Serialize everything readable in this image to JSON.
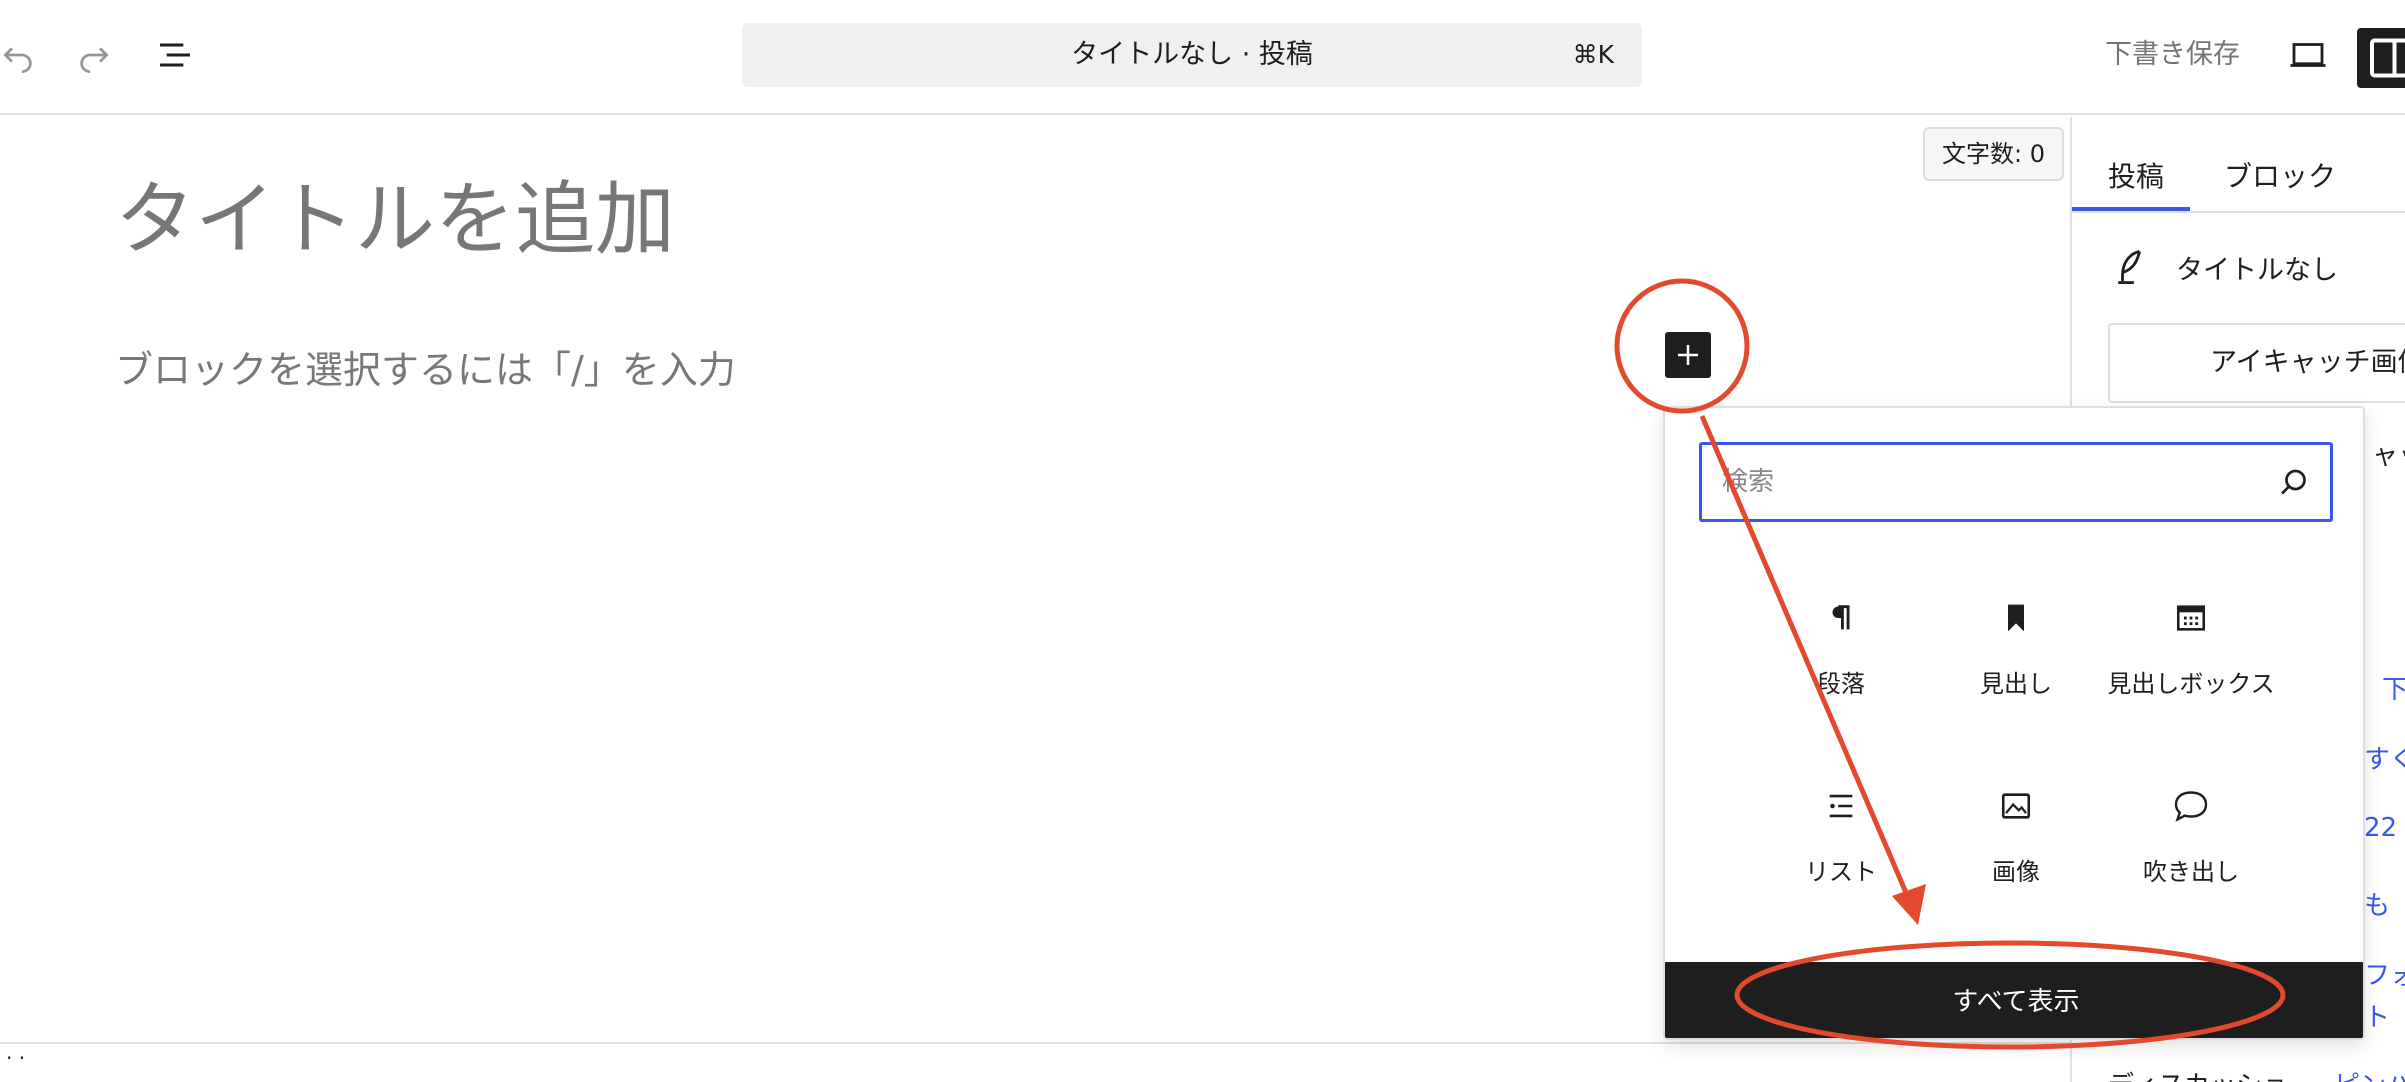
{
  "toolbar": {
    "undo_icon": "undo-icon",
    "redo_icon": "redo-icon",
    "list_view_icon": "list-view-icon",
    "document_title": "タイトルなし · 投稿",
    "shortcut": "⌘K",
    "save_draft": "下書き保存",
    "preview_icon": "desktop-icon",
    "settings_icon": "sidebar-icon"
  },
  "editor": {
    "word_count": "文字数: 0",
    "title_placeholder": "タイトルを追加",
    "block_placeholder": "ブロックを選択するには「/」を入力",
    "inserter_icon": "plus-icon"
  },
  "sidebar": {
    "tabs": [
      {
        "label": "投稿"
      },
      {
        "label": "ブロック"
      }
    ],
    "post_title": "タイトルなし",
    "featured_image_button": "アイキャッチ画像",
    "fragments": {
      "f1": "ャッ",
      "f2": "下",
      "f3": "すぐ",
      "f4": "22",
      "f5": "も",
      "f6": "フォ",
      "f7": "ト",
      "f8": "ディスカッショ",
      "f9": "ピンバ"
    }
  },
  "inserter": {
    "search_placeholder": "検索",
    "blocks": [
      {
        "label": "段落",
        "icon": "paragraph-icon"
      },
      {
        "label": "見出し",
        "icon": "heading-bookmark-icon"
      },
      {
        "label": "見出しボックス",
        "icon": "heading-box-icon"
      },
      {
        "label": "リスト",
        "icon": "list-icon"
      },
      {
        "label": "画像",
        "icon": "image-icon"
      },
      {
        "label": "吹き出し",
        "icon": "speech-bubble-icon"
      }
    ],
    "show_all": "すべて表示"
  },
  "colors": {
    "accent": "#3858e9",
    "annotation": "#e34a2d",
    "dark": "#1e1e1e"
  }
}
